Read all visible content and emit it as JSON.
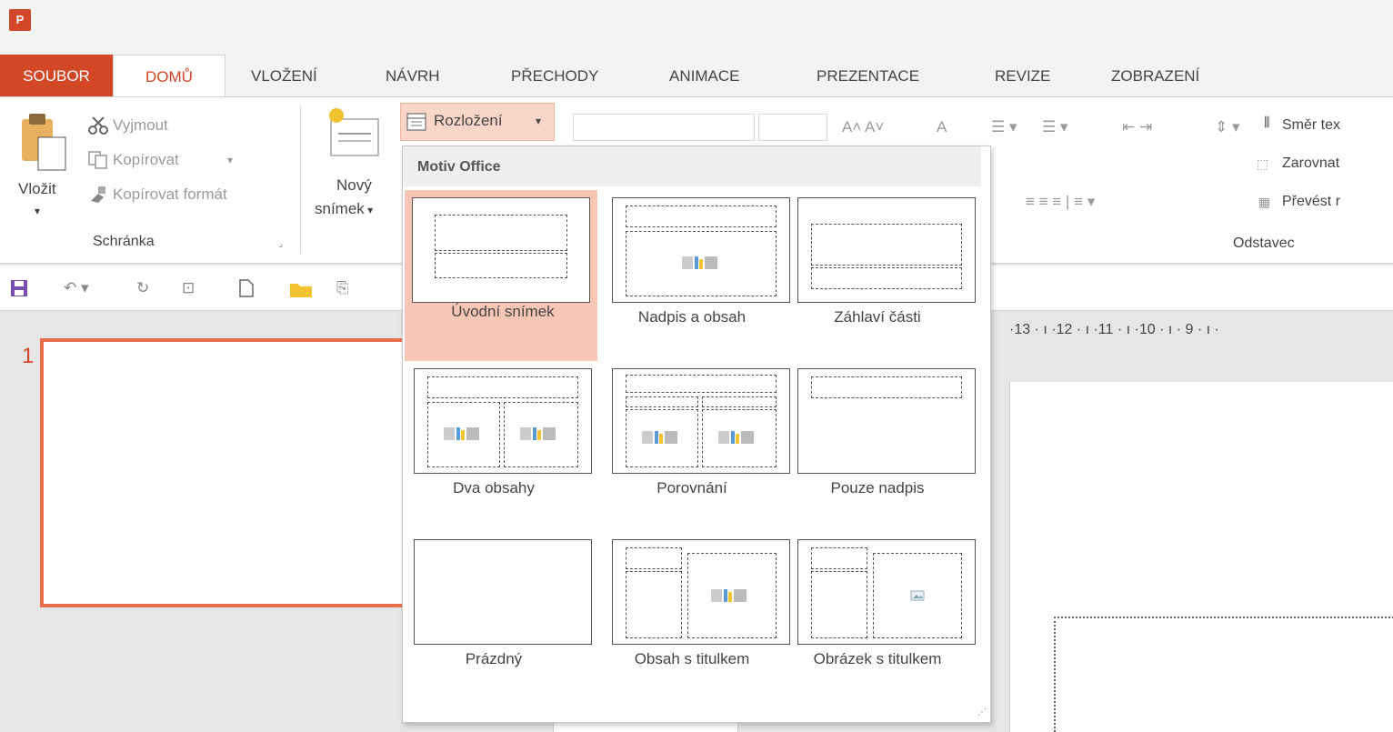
{
  "app": {
    "icon_letter": "P"
  },
  "tabs": [
    "SOUBOR",
    "DOMŮ",
    "VLOŽENÍ",
    "NÁVRH",
    "PŘECHODY",
    "ANIMACE",
    "PREZENTACE",
    "REVIZE",
    "ZOBRAZENÍ"
  ],
  "ribbon": {
    "paste": "Vložit",
    "cut": "Vyjmout",
    "copy": "Kopírovat",
    "format_painter": "Kopírovat formát",
    "clipboard_group": "Schránka",
    "new_slide_1": "Nový",
    "new_slide_2": "snímek",
    "layout_button": "Rozložení",
    "text_direction": "Směr tex",
    "align_text": "Zarovnat",
    "convert": "Převést r",
    "paragraph_group": "Odstavec"
  },
  "ruler": "·13 · ı ·12 · ı ·11 · ı ·10 · ı · 9 · ı ·",
  "slide_panel": {
    "slide_number": "1"
  },
  "dropdown": {
    "header": "Motiv Office",
    "layouts": [
      {
        "label": "Úvodní snímek",
        "selected": true
      },
      {
        "label": "Nadpis a obsah",
        "selected": false
      },
      {
        "label": "Záhlaví části",
        "selected": false
      },
      {
        "label": "Dva obsahy",
        "selected": false
      },
      {
        "label": "Porovnání",
        "selected": false
      },
      {
        "label": "Pouze nadpis",
        "selected": false
      },
      {
        "label": "Prázdný",
        "selected": false
      },
      {
        "label": "Obsah s titulkem",
        "selected": false
      },
      {
        "label": "Obrázek s titulkem",
        "selected": false
      }
    ]
  },
  "colors": {
    "accent": "#d24726",
    "selected_layout": "#f7c6b4",
    "slide_border": "#e4704b"
  }
}
